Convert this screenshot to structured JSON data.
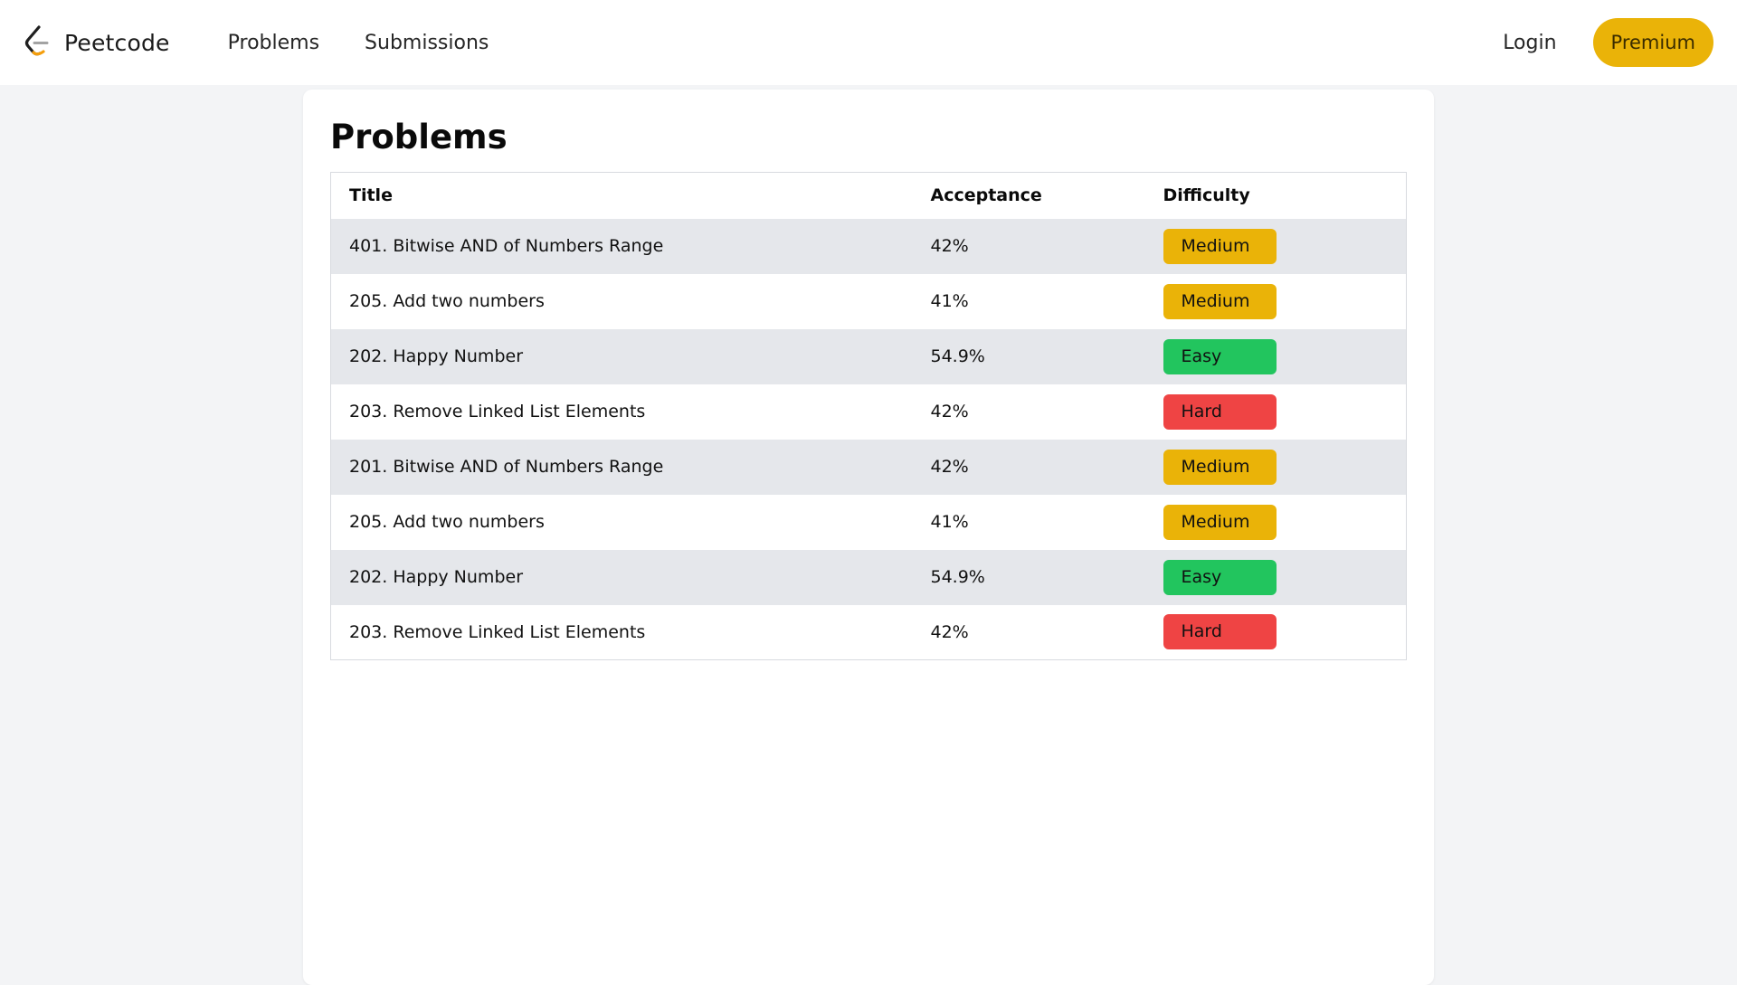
{
  "app": {
    "name": "Peetcode",
    "logo_icon": "peetcode-logo-icon"
  },
  "nav": {
    "links": [
      "Problems",
      "Submissions"
    ],
    "login_label": "Login",
    "premium_label": "Premium"
  },
  "main": {
    "title": "Problems",
    "table": {
      "headers": {
        "title": "Title",
        "acceptance": "Acceptance",
        "difficulty": "Difficulty"
      },
      "rows": [
        {
          "title": "401. Bitwise AND of Numbers Range",
          "acceptance": "42%",
          "difficulty": "Medium"
        },
        {
          "title": "205. Add two numbers",
          "acceptance": "41%",
          "difficulty": "Medium"
        },
        {
          "title": "202. Happy Number",
          "acceptance": "54.9%",
          "difficulty": "Easy"
        },
        {
          "title": "203. Remove Linked List Elements",
          "acceptance": "42%",
          "difficulty": "Hard"
        },
        {
          "title": "201. Bitwise AND of Numbers Range",
          "acceptance": "42%",
          "difficulty": "Medium"
        },
        {
          "title": "205. Add two numbers",
          "acceptance": "41%",
          "difficulty": "Medium"
        },
        {
          "title": "202. Happy Number",
          "acceptance": "54.9%",
          "difficulty": "Easy"
        },
        {
          "title": "203. Remove Linked List Elements",
          "acceptance": "42%",
          "difficulty": "Hard"
        }
      ]
    }
  },
  "colors": {
    "page_background": "#f3f4f6",
    "medium": "#eab308",
    "easy": "#22c55e",
    "hard": "#ef4444",
    "row_stripe": "#e5e7eb",
    "premium_button": "#eab308"
  }
}
